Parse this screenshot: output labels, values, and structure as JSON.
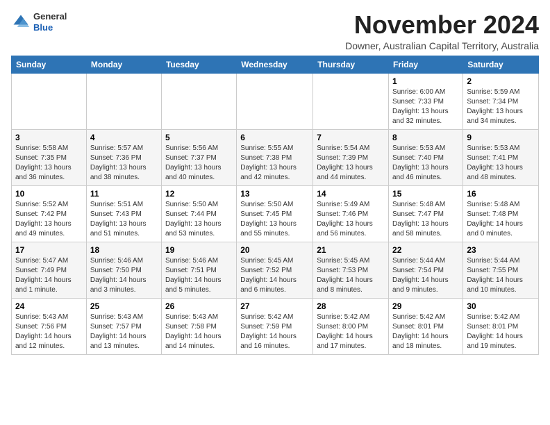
{
  "header": {
    "logo_line1": "General",
    "logo_line2": "Blue",
    "title": "November 2024",
    "subtitle": "Downer, Australian Capital Territory, Australia"
  },
  "weekdays": [
    "Sunday",
    "Monday",
    "Tuesday",
    "Wednesday",
    "Thursday",
    "Friday",
    "Saturday"
  ],
  "weeks": [
    [
      {
        "day": "",
        "info": ""
      },
      {
        "day": "",
        "info": ""
      },
      {
        "day": "",
        "info": ""
      },
      {
        "day": "",
        "info": ""
      },
      {
        "day": "",
        "info": ""
      },
      {
        "day": "1",
        "info": "Sunrise: 6:00 AM\nSunset: 7:33 PM\nDaylight: 13 hours\nand 32 minutes."
      },
      {
        "day": "2",
        "info": "Sunrise: 5:59 AM\nSunset: 7:34 PM\nDaylight: 13 hours\nand 34 minutes."
      }
    ],
    [
      {
        "day": "3",
        "info": "Sunrise: 5:58 AM\nSunset: 7:35 PM\nDaylight: 13 hours\nand 36 minutes."
      },
      {
        "day": "4",
        "info": "Sunrise: 5:57 AM\nSunset: 7:36 PM\nDaylight: 13 hours\nand 38 minutes."
      },
      {
        "day": "5",
        "info": "Sunrise: 5:56 AM\nSunset: 7:37 PM\nDaylight: 13 hours\nand 40 minutes."
      },
      {
        "day": "6",
        "info": "Sunrise: 5:55 AM\nSunset: 7:38 PM\nDaylight: 13 hours\nand 42 minutes."
      },
      {
        "day": "7",
        "info": "Sunrise: 5:54 AM\nSunset: 7:39 PM\nDaylight: 13 hours\nand 44 minutes."
      },
      {
        "day": "8",
        "info": "Sunrise: 5:53 AM\nSunset: 7:40 PM\nDaylight: 13 hours\nand 46 minutes."
      },
      {
        "day": "9",
        "info": "Sunrise: 5:53 AM\nSunset: 7:41 PM\nDaylight: 13 hours\nand 48 minutes."
      }
    ],
    [
      {
        "day": "10",
        "info": "Sunrise: 5:52 AM\nSunset: 7:42 PM\nDaylight: 13 hours\nand 49 minutes."
      },
      {
        "day": "11",
        "info": "Sunrise: 5:51 AM\nSunset: 7:43 PM\nDaylight: 13 hours\nand 51 minutes."
      },
      {
        "day": "12",
        "info": "Sunrise: 5:50 AM\nSunset: 7:44 PM\nDaylight: 13 hours\nand 53 minutes."
      },
      {
        "day": "13",
        "info": "Sunrise: 5:50 AM\nSunset: 7:45 PM\nDaylight: 13 hours\nand 55 minutes."
      },
      {
        "day": "14",
        "info": "Sunrise: 5:49 AM\nSunset: 7:46 PM\nDaylight: 13 hours\nand 56 minutes."
      },
      {
        "day": "15",
        "info": "Sunrise: 5:48 AM\nSunset: 7:47 PM\nDaylight: 13 hours\nand 58 minutes."
      },
      {
        "day": "16",
        "info": "Sunrise: 5:48 AM\nSunset: 7:48 PM\nDaylight: 14 hours\nand 0 minutes."
      }
    ],
    [
      {
        "day": "17",
        "info": "Sunrise: 5:47 AM\nSunset: 7:49 PM\nDaylight: 14 hours\nand 1 minute."
      },
      {
        "day": "18",
        "info": "Sunrise: 5:46 AM\nSunset: 7:50 PM\nDaylight: 14 hours\nand 3 minutes."
      },
      {
        "day": "19",
        "info": "Sunrise: 5:46 AM\nSunset: 7:51 PM\nDaylight: 14 hours\nand 5 minutes."
      },
      {
        "day": "20",
        "info": "Sunrise: 5:45 AM\nSunset: 7:52 PM\nDaylight: 14 hours\nand 6 minutes."
      },
      {
        "day": "21",
        "info": "Sunrise: 5:45 AM\nSunset: 7:53 PM\nDaylight: 14 hours\nand 8 minutes."
      },
      {
        "day": "22",
        "info": "Sunrise: 5:44 AM\nSunset: 7:54 PM\nDaylight: 14 hours\nand 9 minutes."
      },
      {
        "day": "23",
        "info": "Sunrise: 5:44 AM\nSunset: 7:55 PM\nDaylight: 14 hours\nand 10 minutes."
      }
    ],
    [
      {
        "day": "24",
        "info": "Sunrise: 5:43 AM\nSunset: 7:56 PM\nDaylight: 14 hours\nand 12 minutes."
      },
      {
        "day": "25",
        "info": "Sunrise: 5:43 AM\nSunset: 7:57 PM\nDaylight: 14 hours\nand 13 minutes."
      },
      {
        "day": "26",
        "info": "Sunrise: 5:43 AM\nSunset: 7:58 PM\nDaylight: 14 hours\nand 14 minutes."
      },
      {
        "day": "27",
        "info": "Sunrise: 5:42 AM\nSunset: 7:59 PM\nDaylight: 14 hours\nand 16 minutes."
      },
      {
        "day": "28",
        "info": "Sunrise: 5:42 AM\nSunset: 8:00 PM\nDaylight: 14 hours\nand 17 minutes."
      },
      {
        "day": "29",
        "info": "Sunrise: 5:42 AM\nSunset: 8:01 PM\nDaylight: 14 hours\nand 18 minutes."
      },
      {
        "day": "30",
        "info": "Sunrise: 5:42 AM\nSunset: 8:01 PM\nDaylight: 14 hours\nand 19 minutes."
      }
    ]
  ]
}
